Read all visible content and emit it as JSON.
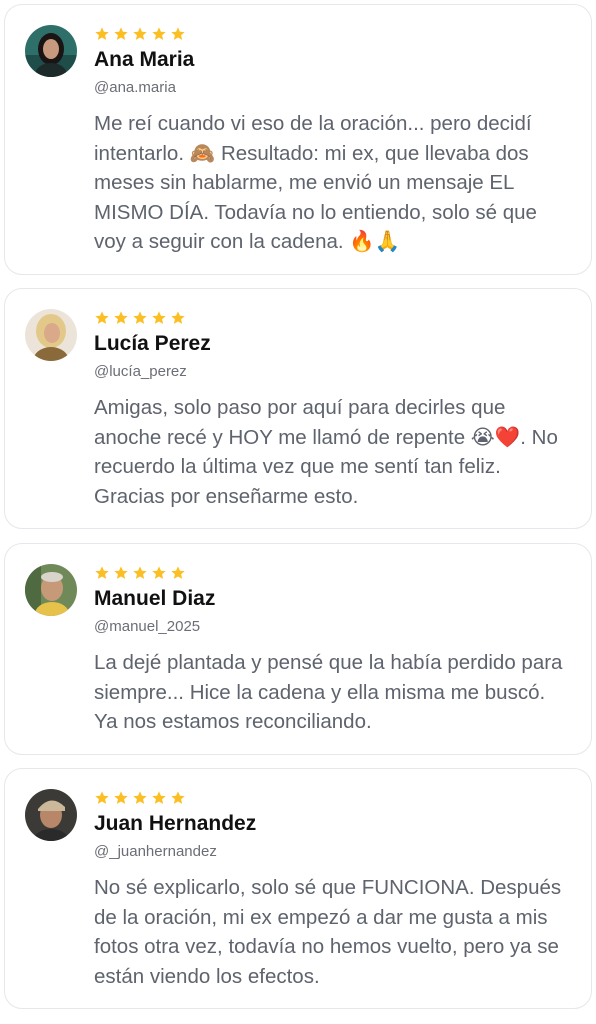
{
  "reviews": [
    {
      "rating": 5,
      "name": "Ana Maria",
      "handle": "@ana.maria",
      "text": "Me reí cuando vi eso de la oración... pero decidí intentarlo. 🙈 Resultado: mi ex, que llevaba dos meses sin hablarme, me envió un mensaje EL MISMO DÍA. Todavía no lo entiendo, solo sé que voy a seguir con la cadena. 🔥🙏",
      "avatar_bg": "#2f6f6a"
    },
    {
      "rating": 5,
      "name": "Lucía Perez",
      "handle": "@lucía_perez",
      "text": "Amigas, solo paso por aquí para decirles que anoche recé y HOY me llamó de repente 😭❤️. No recuerdo la última vez que me sentí tan feliz. Gracias por enseñarme esto.",
      "avatar_bg": "#e8d8c2"
    },
    {
      "rating": 5,
      "name": "Manuel Diaz",
      "handle": "@manuel_2025",
      "text": "La dejé plantada y pensé que la había perdido para siempre... Hice la cadena y ella misma me buscó. Ya nos estamos reconciliando.",
      "avatar_bg": "#6f8a58"
    },
    {
      "rating": 5,
      "name": "Juan Hernandez",
      "handle": "@_juanhernandez",
      "text": "No sé explicarlo, solo sé que FUNCIONA. Después de la oración, mi ex empezó a dar me gusta a mis fotos otra vez, todavía no hemos vuelto, pero ya se están viendo los efectos.",
      "avatar_bg": "#3b3a36"
    }
  ],
  "colors": {
    "star": "#fbbf24",
    "name": "#111111",
    "handle": "#6b6e76",
    "text": "#5e636d",
    "border": "#e6e7eb"
  }
}
